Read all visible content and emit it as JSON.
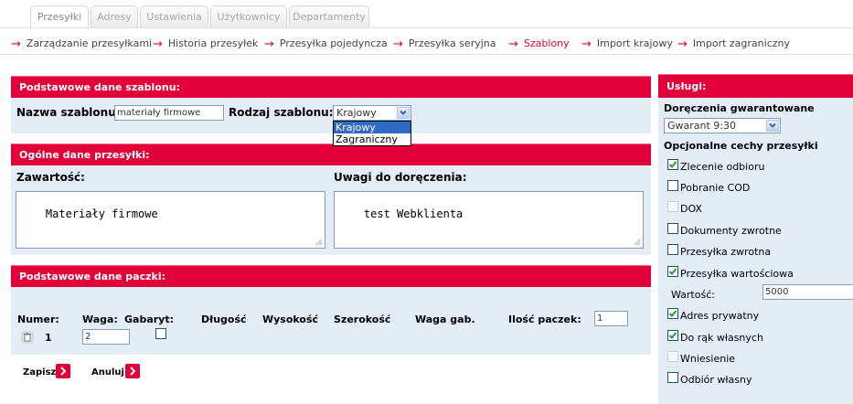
{
  "tabs": [
    "Przesyłki",
    "Adresy",
    "Ustawienia",
    "Użytkownicy",
    "Departamenty"
  ],
  "subnav": [
    "Zarządzanie przesyłkami",
    "Historia przesyłek",
    "Przesyłka pojedyncza",
    "Przesyłka seryjna",
    "Szablony",
    "Import krajowy",
    "Import zagraniczny"
  ],
  "template": {
    "header": "Podstawowe dane szablonu:",
    "name_label": "Nazwa szablonu:",
    "name_value": "materiały firmowe",
    "type_label": "Rodzaj szablonu:",
    "type_value": "Krajowy",
    "type_options": [
      "Krajowy",
      "Zagraniczny"
    ]
  },
  "general": {
    "header": "Ogólne dane przesyłki:",
    "content_label": "Zawartość:",
    "content_value": "Materiały firmowe",
    "notes_label": "Uwagi do doręczenia:",
    "notes_value": "test Webklienta"
  },
  "package": {
    "header": "Podstawowe dane paczki:",
    "columns": [
      "Numer:",
      "Waga:",
      "Gabaryt:",
      "Długość",
      "Wysokość",
      "Szerokość",
      "Waga gab.",
      "Ilość paczek:"
    ],
    "count_value": "1",
    "row_number": "1",
    "weight_value": "2"
  },
  "actions": {
    "save": "Zapisz",
    "cancel": "Anuluj"
  },
  "services": {
    "header": "Usługi:",
    "guaranteed_label": "Doręczenia gwarantowane",
    "guaranteed_value": "Gwarant 9:30",
    "optional_label": "Opcjonalne cechy przesyłki",
    "options": [
      {
        "label": "Zlecenie odbioru",
        "checked": true
      },
      {
        "label": "Pobranie COD",
        "checked": false
      },
      {
        "label": "DOX",
        "checked": false,
        "disabled": true
      },
      {
        "label": "Dokumenty zwrotne",
        "checked": false
      },
      {
        "label": "Przesyłka zwrotna",
        "checked": false
      },
      {
        "label": "Przesyłka wartościowa",
        "checked": true
      },
      {
        "label": "Adres prywatny",
        "checked": true
      },
      {
        "label": "Do rąk własnych",
        "checked": true
      },
      {
        "label": "Wniesienie",
        "checked": false,
        "disabled": true
      },
      {
        "label": "Odbiór własny",
        "checked": false
      }
    ],
    "value_label": "Wartość:",
    "value_value": "5000"
  },
  "colors": {
    "accent": "#e2003a",
    "panel_bg": "#e4ecf6"
  }
}
